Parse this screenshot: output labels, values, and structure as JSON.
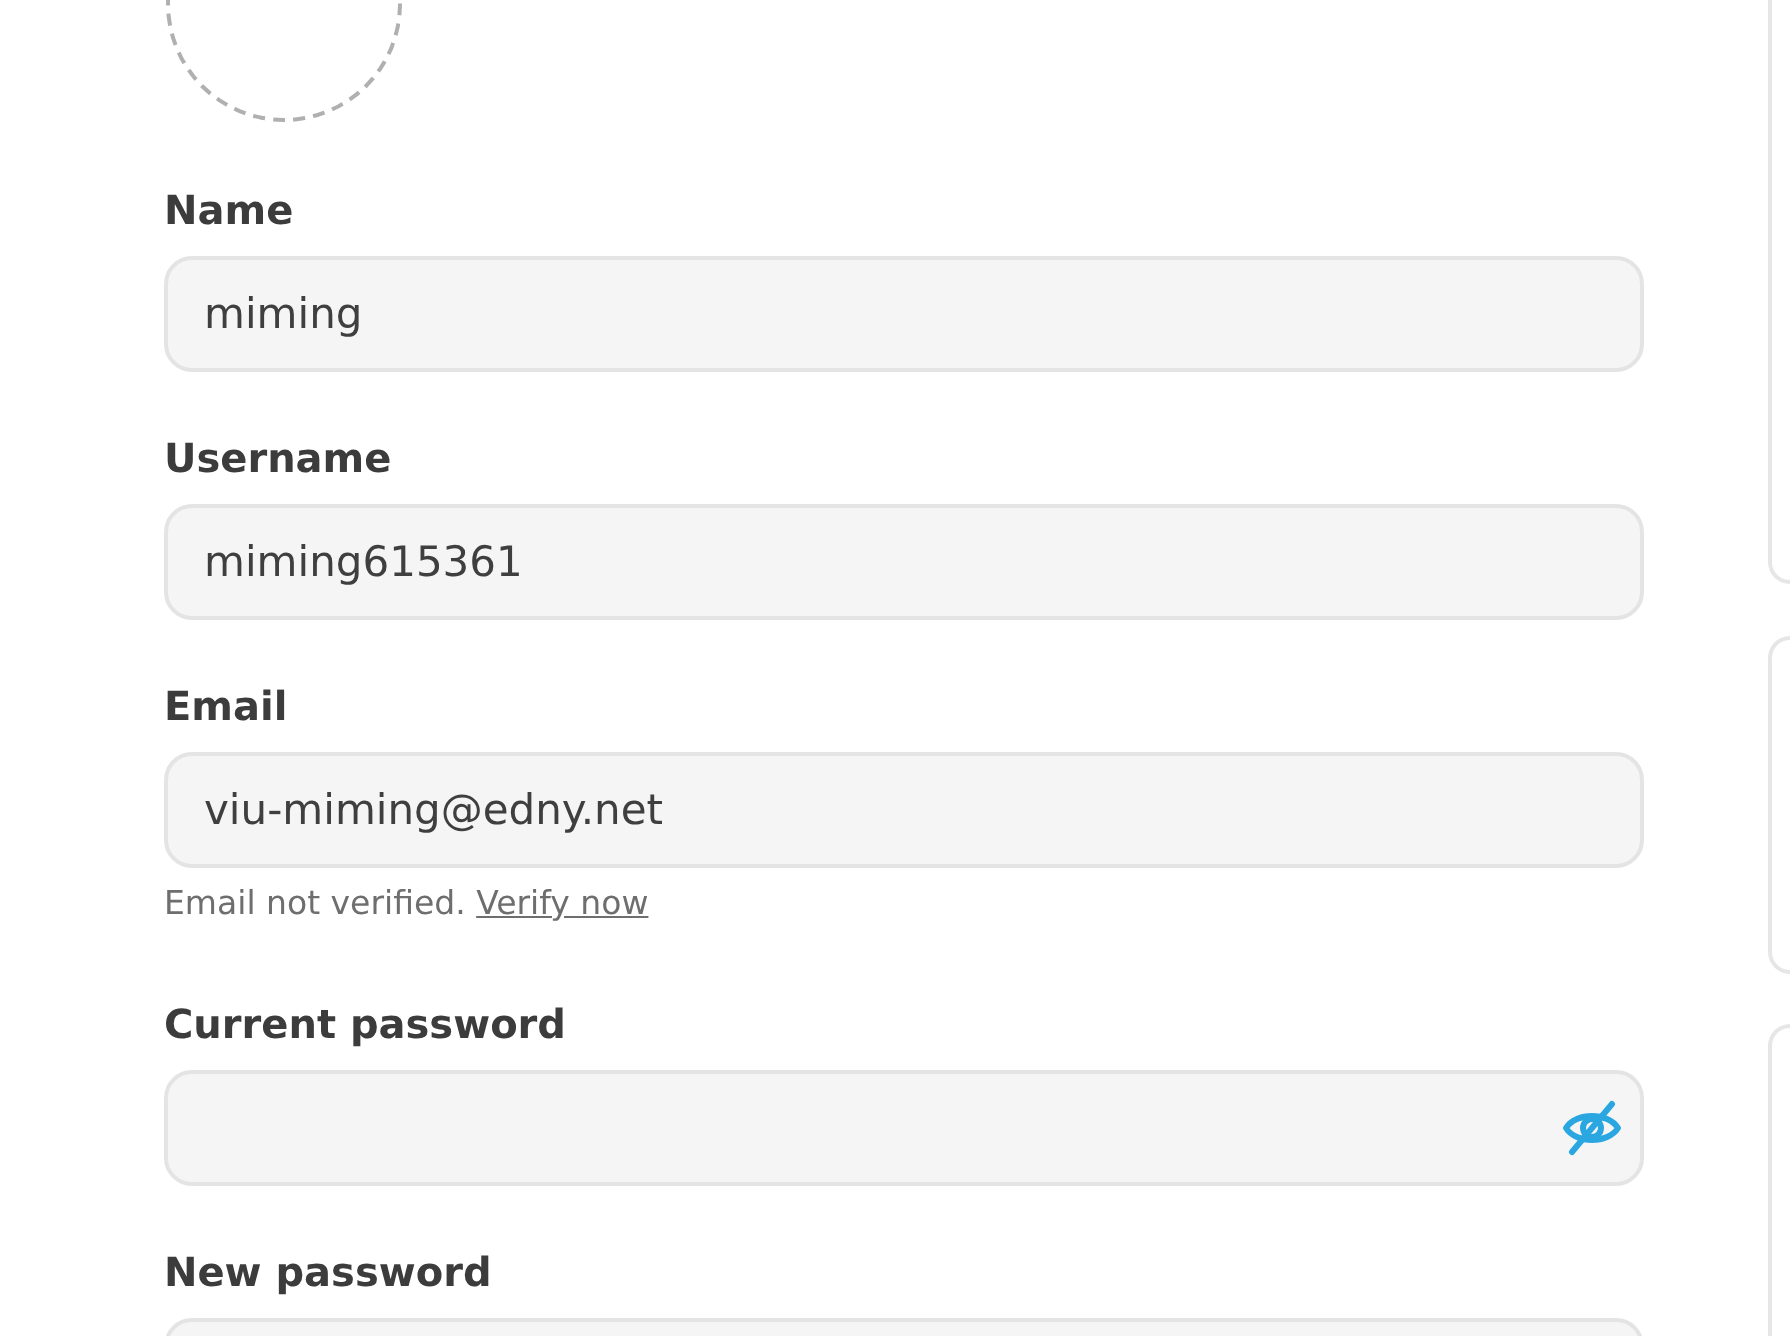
{
  "fields": [
    {
      "kind": "text",
      "label": "Name",
      "value": "miming"
    },
    {
      "kind": "text",
      "label": "Username",
      "value": "miming615361"
    },
    {
      "kind": "text",
      "label": "Email",
      "value": "viu-miming@edny.net",
      "hint": "Email not verified.",
      "hint_link": "Verify now"
    },
    {
      "kind": "password",
      "label": "Current password",
      "revealed": false
    },
    {
      "kind": "password",
      "label": "New password"
    }
  ]
}
